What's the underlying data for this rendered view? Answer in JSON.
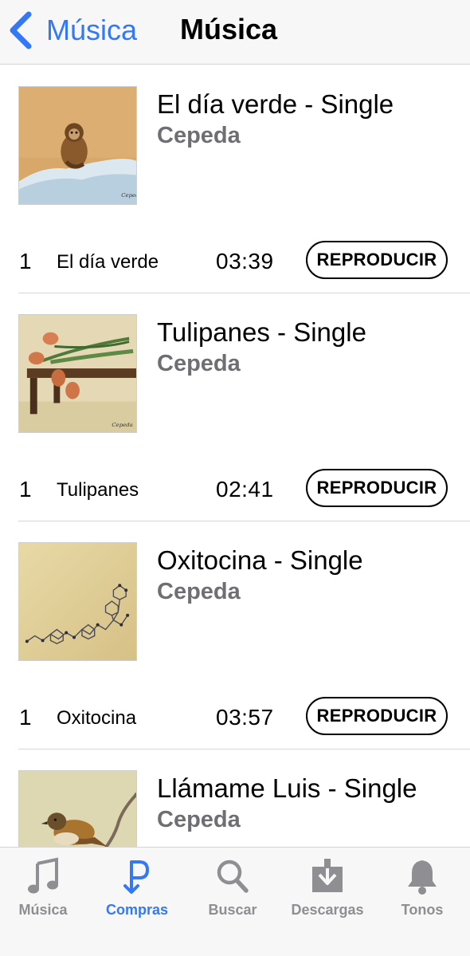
{
  "colors": {
    "accent": "#3478f6",
    "inactive": "#8e8e93",
    "secondary_text": "#6e6e73"
  },
  "navbar": {
    "back_label": "Música",
    "title": "Música",
    "back_icon": "chevron-left-icon"
  },
  "albums": [
    {
      "title": "El día verde - Single",
      "artist": "Cepeda",
      "artwork": "monkey-on-snow-painting",
      "track": {
        "number": "1",
        "name": "El día verde",
        "duration": "03:39",
        "button": "REPRODUCIR"
      }
    },
    {
      "title": "Tulipanes - Single",
      "artist": "Cepeda",
      "artwork": "tulips-on-bench-painting",
      "track": {
        "number": "1",
        "name": "Tulipanes",
        "duration": "02:41",
        "button": "REPRODUCIR"
      }
    },
    {
      "title": "Oxitocina - Single",
      "artist": "Cepeda",
      "artwork": "molecule-structure-painting",
      "track": {
        "number": "1",
        "name": "Oxitocina",
        "duration": "03:57",
        "button": "REPRODUCIR"
      }
    },
    {
      "title": "Llámame Luis - Single",
      "artist": "Cepeda",
      "artwork": "bird-on-branch-painting"
    }
  ],
  "tabbar": {
    "tabs": [
      {
        "label": "Música",
        "icon": "music-note-icon",
        "active": false
      },
      {
        "label": "Compras",
        "icon": "purchases-icon",
        "active": true
      },
      {
        "label": "Buscar",
        "icon": "search-icon",
        "active": false
      },
      {
        "label": "Descargas",
        "icon": "download-icon",
        "active": false
      },
      {
        "label": "Tonos",
        "icon": "bell-icon",
        "active": false
      }
    ]
  }
}
